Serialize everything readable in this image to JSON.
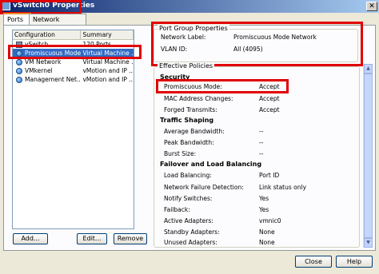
{
  "window": {
    "title": "vSwitch0 Properties",
    "close_glyph": "✕"
  },
  "tabs": [
    {
      "label": "Ports"
    },
    {
      "label": "Network Adapters"
    }
  ],
  "port_list": {
    "headers": {
      "configuration": "Configuration",
      "summary": "Summary"
    },
    "rows": [
      {
        "config": "vSwitch",
        "summary": "120 Ports",
        "icon": "vswitch-icon"
      },
      {
        "config": "Promiscuous Mode...",
        "summary": "Virtual Machine ...",
        "icon": "port-group-icon"
      },
      {
        "config": "VM Network",
        "summary": "Virtual Machine ...",
        "icon": "port-group-icon"
      },
      {
        "config": "VMkernel",
        "summary": "vMotion and IP ...",
        "icon": "port-group-icon"
      },
      {
        "config": "Management Net...",
        "summary": "vMotion and IP ...",
        "icon": "port-group-icon"
      }
    ]
  },
  "list_buttons": {
    "add": "Add...",
    "edit": "Edit...",
    "remove": "Remove"
  },
  "port_group_properties": {
    "title": "Port Group Properties",
    "network_label": {
      "label": "Network Label:",
      "value": "Promiscuous Mode Network"
    },
    "vlan_id": {
      "label": "VLAN ID:",
      "value": "All (4095)"
    }
  },
  "effective_policies": {
    "title": "Effective Policies",
    "security": {
      "heading": "Security",
      "items": [
        {
          "label": "Promiscuous Mode:",
          "value": "Accept"
        },
        {
          "label": "MAC Address Changes:",
          "value": "Accept"
        },
        {
          "label": "Forged Transmits:",
          "value": "Accept"
        }
      ]
    },
    "traffic_shaping": {
      "heading": "Traffic Shaping",
      "items": [
        {
          "label": "Average Bandwidth:",
          "value": "--"
        },
        {
          "label": "Peak Bandwidth:",
          "value": "--"
        },
        {
          "label": "Burst Size:",
          "value": "--"
        }
      ]
    },
    "failover": {
      "heading": "Failover and Load Balancing",
      "items": [
        {
          "label": "Load Balancing:",
          "value": "Port ID"
        },
        {
          "label": "Network Failure Detection:",
          "value": "Link status only"
        },
        {
          "label": "Notify Switches:",
          "value": "Yes"
        },
        {
          "label": "Failback:",
          "value": "Yes"
        },
        {
          "label": "Active Adapters:",
          "value": "vmnic0"
        },
        {
          "label": "Standby Adapters:",
          "value": "None"
        },
        {
          "label": "Unused Adapters:",
          "value": "None"
        }
      ]
    }
  },
  "footer": {
    "close": "Close",
    "help": "Help"
  },
  "colors": {
    "highlight": "#e00000",
    "selection": "#316ac5",
    "title_bar": "#0a246a"
  }
}
